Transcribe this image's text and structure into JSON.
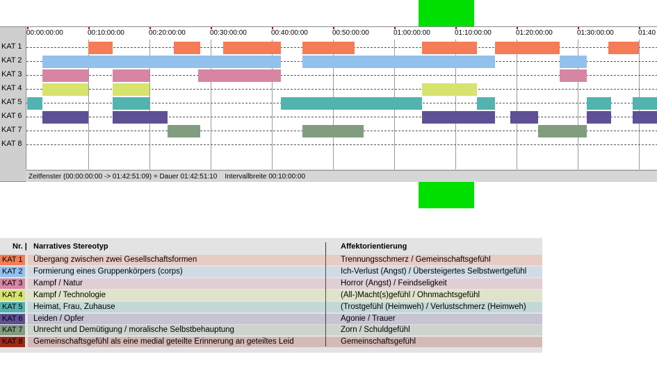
{
  "ruler": {
    "ticks": [
      "00:00:00:00",
      "00:10:00:00",
      "00:20:00:00",
      "00:30:00:00",
      "00:40:00:00",
      "00:50:00:00",
      "01:00:00:00",
      "01:10:00:00",
      "01:20:00:00",
      "01:30:00:00",
      "01:40"
    ]
  },
  "categories": [
    {
      "label": "KAT 1",
      "color": "#f47c56"
    },
    {
      "label": "KAT 2",
      "color": "#92c1ee"
    },
    {
      "label": "KAT 3",
      "color": "#d885a4"
    },
    {
      "label": "KAT 4",
      "color": "#d8e36e"
    },
    {
      "label": "KAT 5",
      "color": "#52b3b0"
    },
    {
      "label": "KAT 6",
      "color": "#5f5095"
    },
    {
      "label": "KAT 7",
      "color": "#819d80"
    },
    {
      "label": "KAT 8",
      "color": "#9e2a1a"
    }
  ],
  "segments_minutes": [
    [
      [
        10,
        14
      ],
      [
        24,
        28.3
      ],
      [
        32,
        41.5
      ],
      [
        45,
        53.5
      ],
      [
        64.5,
        73.5
      ],
      [
        76.5,
        87
      ],
      [
        95,
        100
      ]
    ],
    [
      [
        2.5,
        41.5
      ],
      [
        45,
        76.5
      ],
      [
        87,
        91.5
      ]
    ],
    [
      [
        2.5,
        10
      ],
      [
        14,
        20
      ],
      [
        28,
        41.5
      ],
      [
        87,
        91.5
      ]
    ],
    [
      [
        2.5,
        10
      ],
      [
        14,
        20
      ],
      [
        64.5,
        73.5
      ]
    ],
    [
      [
        0,
        2.5
      ],
      [
        14,
        20
      ],
      [
        41.5,
        64.5
      ],
      [
        73.5,
        76.5
      ],
      [
        91.5,
        95.5
      ],
      [
        99,
        103
      ]
    ],
    [
      [
        2.5,
        10
      ],
      [
        14,
        23
      ],
      [
        64.5,
        76.5
      ],
      [
        79,
        83.5
      ],
      [
        91.5,
        95.5
      ],
      [
        99,
        103
      ]
    ],
    [
      [
        23,
        28.3
      ],
      [
        45,
        55
      ],
      [
        83.5,
        91.5
      ]
    ],
    []
  ],
  "status": {
    "text": "Zeitfenster (00:00:00:00 -> 01:42:51:09) = Dauer 01:42:51:10    Intervallbreite 00:10:00:00"
  },
  "legend": {
    "header_nr": "Nr.",
    "header_stereotyp": "Narratives Stereotyp",
    "header_affekt": "Affektorientierung",
    "rows": [
      {
        "kat": "KAT 1",
        "stereotyp": "Übergang zwischen zwei Gesellschaftsformen",
        "affekt": "Trennungsschmerz / Gemeinschaftsgefühl"
      },
      {
        "kat": "KAT 2",
        "stereotyp": "Formierung eines Gruppenkörpers (corps)",
        "affekt": "Ich-Verlust (Angst) / Übersteigertes Selbstwertgefühl"
      },
      {
        "kat": "KAT 3",
        "stereotyp": "Kampf / Natur",
        "affekt": "Horror (Angst) / Feindseligkeit"
      },
      {
        "kat": "KAT 4",
        "stereotyp": "Kampf / Technologie",
        "affekt": "(All-)Macht(s)gefühl / Ohnmachtsgefühl"
      },
      {
        "kat": "KAT 5",
        "stereotyp": "Heimat, Frau, Zuhause",
        "affekt": "(Trostgefühl (Heimweh) / Verlustschmerz (Heimweh)"
      },
      {
        "kat": "KAT 6",
        "stereotyp": "Leiden / Opfer",
        "affekt": "Agonie / Trauer"
      },
      {
        "kat": "KAT 7",
        "stereotyp": "Unrecht und Demütigung / moralische Selbstbehauptung",
        "affekt": "Zorn / Schuldgefühl"
      },
      {
        "kat": "KAT 8",
        "stereotyp": "Gemeinschaftsgefühl als eine medial geteilte Erinnerung an geteiltes Leid",
        "affekt": "Gemeinschaftsgefühl"
      }
    ]
  }
}
